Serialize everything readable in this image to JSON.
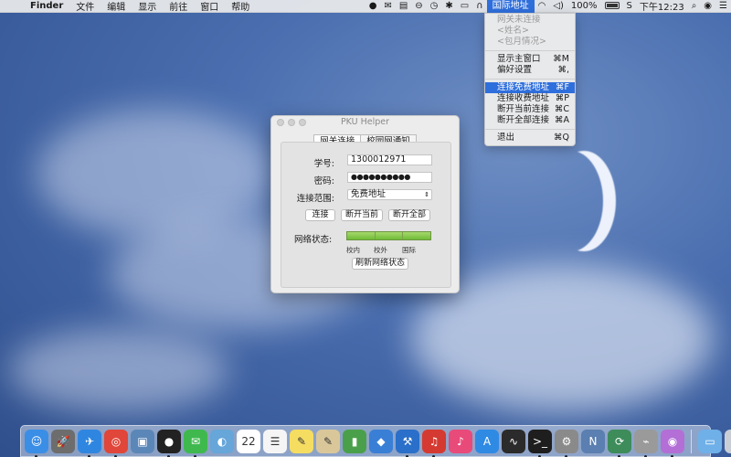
{
  "menubar": {
    "apple": "",
    "app_name": "Finder",
    "menus": [
      "文件",
      "编辑",
      "显示",
      "前往",
      "窗口",
      "帮助"
    ],
    "status_item_active": "国际地址",
    "battery": "100%",
    "clock": "下午12:23"
  },
  "dropdown": {
    "disabled_items": [
      "网关未连接",
      "<姓名>",
      "<包月情况>"
    ],
    "items": [
      {
        "label": "显示主窗口",
        "shortcut": "⌘M"
      },
      {
        "label": "偏好设置",
        "shortcut": "⌘,"
      }
    ],
    "connect_items": [
      {
        "label": "连接免费地址",
        "shortcut": "⌘F",
        "highlighted": true
      },
      {
        "label": "连接收费地址",
        "shortcut": "⌘P"
      },
      {
        "label": "断开当前连接",
        "shortcut": "⌘C"
      },
      {
        "label": "断开全部连接",
        "shortcut": "⌘A"
      }
    ],
    "quit": {
      "label": "退出",
      "shortcut": "⌘Q"
    }
  },
  "window": {
    "title": "PKU Helper",
    "tabs": [
      "网关连接",
      "校园网通知"
    ],
    "student_id_label": "学号:",
    "student_id_value": "1300012971",
    "password_label": "密码:",
    "password_value": "●●●●●●●●●●",
    "scope_label": "连接范围:",
    "scope_value": "免费地址",
    "buttons": {
      "connect": "连接",
      "disconnect_current": "断开当前",
      "disconnect_all": "断开全部",
      "refresh": "刷新网络状态"
    },
    "net_status_label": "网络状态:",
    "net_labels": [
      "校内",
      "校外",
      "国际"
    ]
  },
  "dock": {
    "apps": [
      {
        "name": "finder-icon",
        "glyph": "☺",
        "color": "#3b8ee6"
      },
      {
        "name": "launchpad-icon",
        "glyph": "🚀",
        "color": "#6d6d6d"
      },
      {
        "name": "safari-icon",
        "glyph": "✈",
        "color": "#2f86e0"
      },
      {
        "name": "chrome-icon",
        "glyph": "◎",
        "color": "#e0463a"
      },
      {
        "name": "preview-icon",
        "glyph": "▣",
        "color": "#5b87b8"
      },
      {
        "name": "qq-icon",
        "glyph": "●",
        "color": "#222222"
      },
      {
        "name": "wechat-icon",
        "glyph": "✉",
        "color": "#3fb94e"
      },
      {
        "name": "tweetbot-icon",
        "glyph": "◐",
        "color": "#66a6d9"
      },
      {
        "name": "calendar-icon",
        "glyph": "22",
        "color": "#ffffff"
      },
      {
        "name": "reminders-icon",
        "glyph": "☰",
        "color": "#f5f5f5"
      },
      {
        "name": "notes-icon",
        "glyph": "✎",
        "color": "#f5dd62"
      },
      {
        "name": "textedit-icon",
        "glyph": "✎",
        "color": "#d9c79a"
      },
      {
        "name": "numbers-icon",
        "glyph": "▮",
        "color": "#4aa04a"
      },
      {
        "name": "keynote-icon",
        "glyph": "◆",
        "color": "#3a7fd6"
      },
      {
        "name": "xcode-icon",
        "glyph": "⚒",
        "color": "#2a6fc9"
      },
      {
        "name": "netease-music-icon",
        "glyph": "♫",
        "color": "#d43a31"
      },
      {
        "name": "itunes-icon",
        "glyph": "♪",
        "color": "#e84a7a"
      },
      {
        "name": "appstore-icon",
        "glyph": "A",
        "color": "#2f8ae4"
      },
      {
        "name": "activity-monitor-icon",
        "glyph": "∿",
        "color": "#2b2b2b"
      },
      {
        "name": "terminal-icon",
        "glyph": ">_",
        "color": "#1e1e1e"
      },
      {
        "name": "system-preferences-icon",
        "glyph": "⚙",
        "color": "#8a8a8a"
      },
      {
        "name": "app-n-icon",
        "glyph": "N",
        "color": "#5a7fb0"
      },
      {
        "name": "network-icon",
        "glyph": "⟳",
        "color": "#3d8c5a"
      },
      {
        "name": "utility-icon",
        "glyph": "⌁",
        "color": "#9a9a9a"
      },
      {
        "name": "siri-icon",
        "glyph": "◉",
        "color": "#b36fd6"
      },
      {
        "name": "folder-icon",
        "glyph": "▭",
        "color": "#6fb0e8"
      },
      {
        "name": "trash-icon",
        "glyph": "🗑",
        "color": "#c9ced6"
      }
    ]
  }
}
